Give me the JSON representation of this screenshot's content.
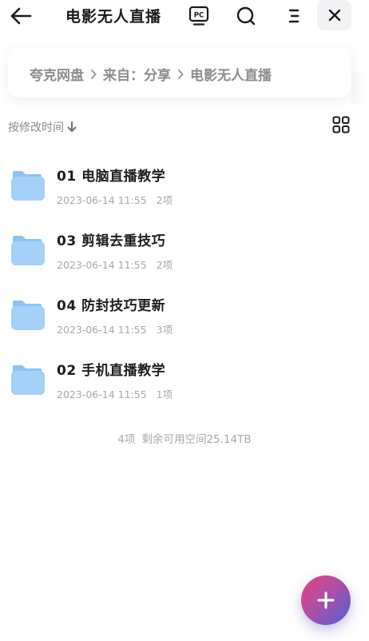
{
  "header": {
    "title": "电影无人直播",
    "pc_label": "PC"
  },
  "breadcrumb": {
    "items": [
      "夸克网盘",
      "来自：分享",
      "电影无人直播"
    ]
  },
  "sort": {
    "label": "按修改时间"
  },
  "files": [
    {
      "name": "01 电脑直播教学",
      "date": "2023-06-14 11:55",
      "count": "2项"
    },
    {
      "name": "03 剪辑去重技巧",
      "date": "2023-06-14 11:55",
      "count": "2项"
    },
    {
      "name": "04 防封技巧更新",
      "date": "2023-06-14 11:55",
      "count": "3项"
    },
    {
      "name": "02 手机直播教学",
      "date": "2023-06-14 11:55",
      "count": "1项"
    }
  ],
  "footer": {
    "count": "4项",
    "space": "剩余可用空间25.14TB"
  },
  "icons": {
    "back": "arrow-left-icon",
    "pc": "pc-monitor-icon",
    "search": "search-icon",
    "menu": "menu-icon",
    "close": "close-icon",
    "grid": "grid-view-icon",
    "folder": "folder-icon",
    "add": "plus-icon"
  },
  "colors": {
    "folder": "#9ccbf5",
    "fab_start": "#ea3f7c",
    "fab_end": "#4f5fd9"
  }
}
